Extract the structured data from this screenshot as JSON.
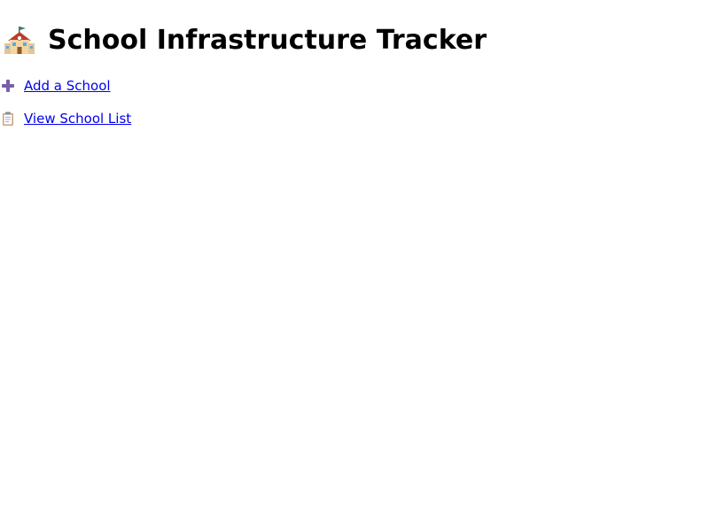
{
  "header": {
    "icon": "school-building-icon",
    "title": "School Infrastructure Tracker"
  },
  "nav": {
    "links": [
      {
        "icon": "plus-icon",
        "label": "Add a School"
      },
      {
        "icon": "clipboard-icon",
        "label": "View School List"
      }
    ]
  },
  "colors": {
    "link": "#0000ee",
    "plus_icon": "#7a5fa8",
    "text": "#000000",
    "background": "#ffffff"
  }
}
